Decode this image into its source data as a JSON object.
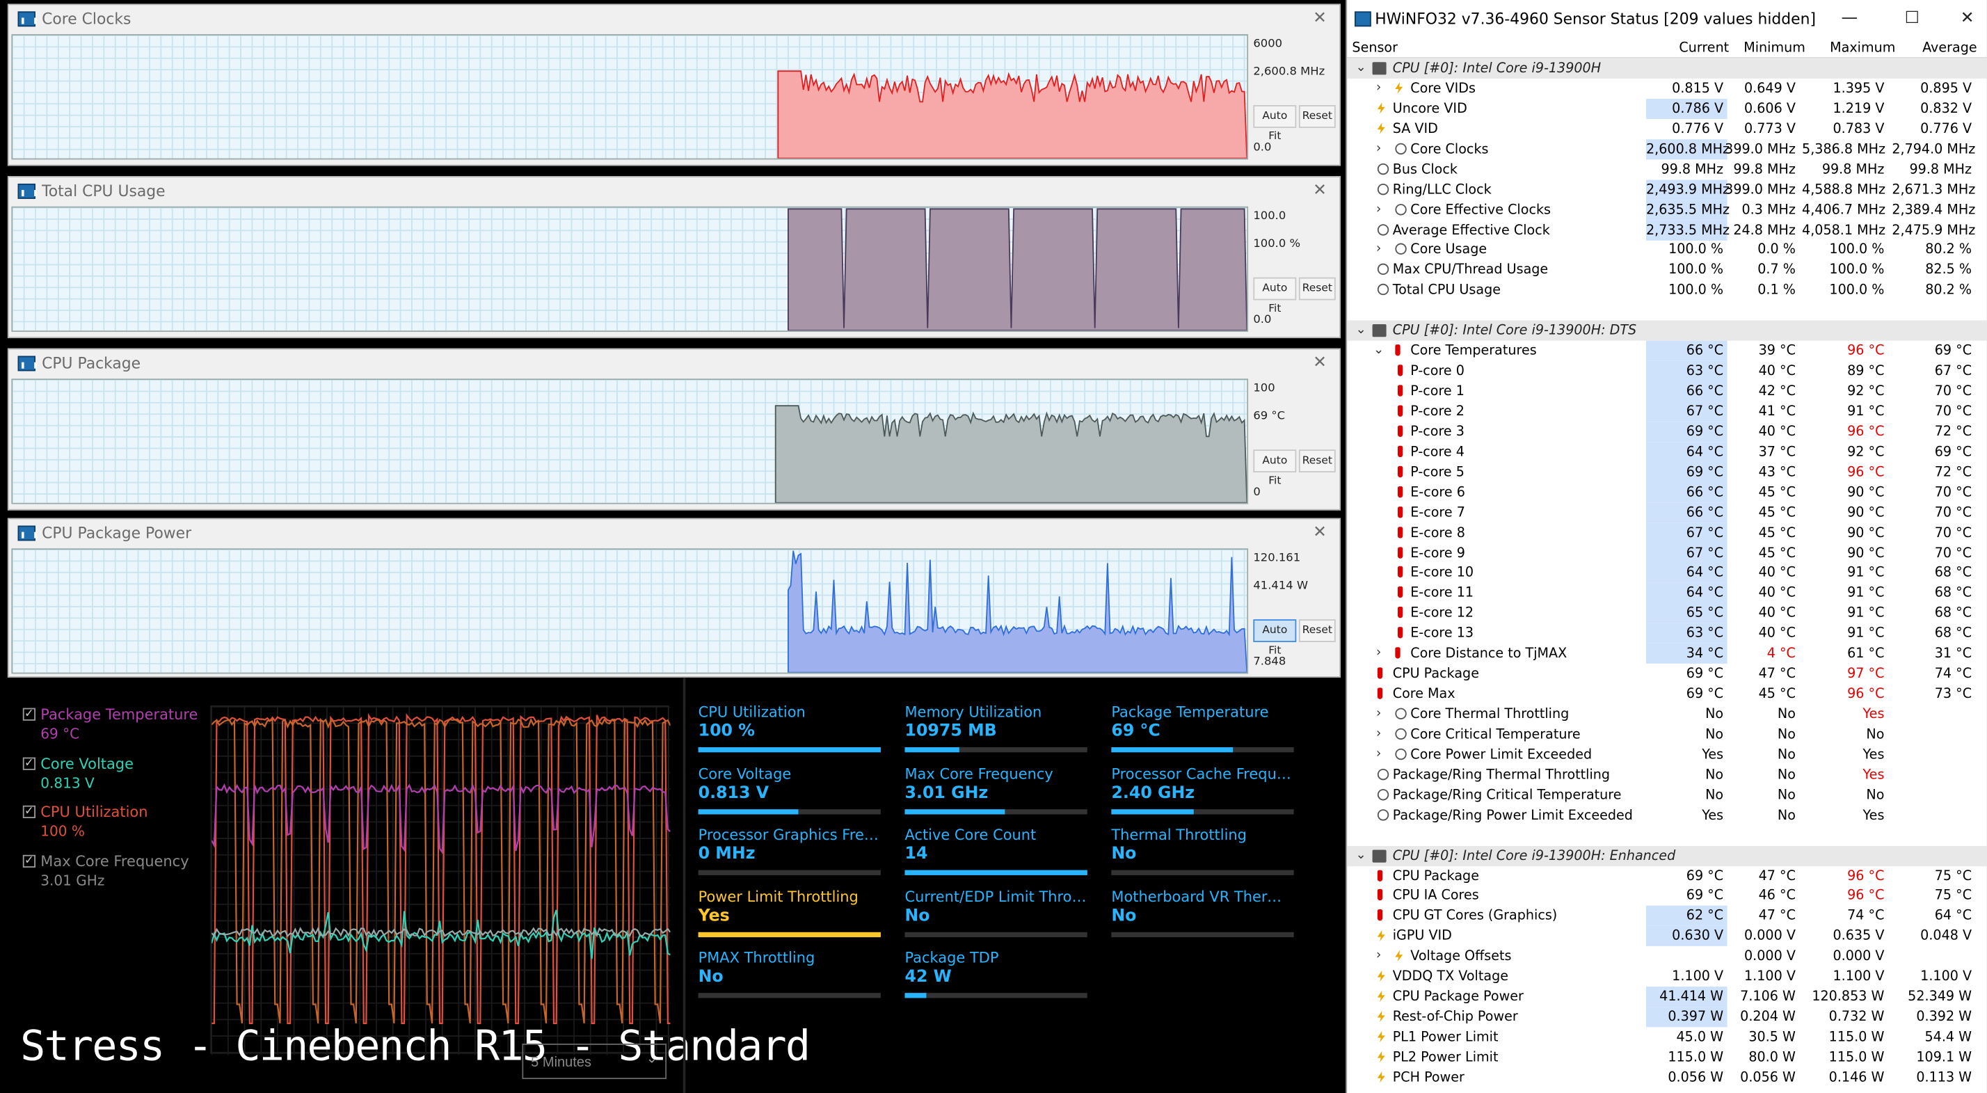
{
  "graphs": [
    {
      "title": "Core Clocks",
      "top_label": "6000",
      "cur_label": "2,600.8 MHz",
      "bottom_label": "0.0",
      "ymax": 6000,
      "fill": "#f7a8a8",
      "line": "#e02020",
      "start": 0.62,
      "base": 0.61,
      "noise": 0.08,
      "style": "normal",
      "autofit_active": false
    },
    {
      "title": "Total CPU Usage",
      "top_label": "100.0",
      "cur_label": "100.0 %",
      "bottom_label": "0.0",
      "ymax": 100,
      "fill": "#a896a8",
      "line": "#4a3a5a",
      "start": 0.628,
      "base": 1.0,
      "noise": 0,
      "style": "pulse",
      "autofit_active": false
    },
    {
      "title": "CPU Package",
      "top_label": "100",
      "cur_label": "69 °C",
      "bottom_label": "0",
      "ymax": 100,
      "fill": "#b2bcbc",
      "line": "#4d5a5a",
      "start": 0.618,
      "base": 0.69,
      "noise": 0.04,
      "style": "normal",
      "autofit_active": false
    },
    {
      "title": "CPU Package Power",
      "top_label": "120.161",
      "cur_label": "41.414 W",
      "bottom_label": "7.848",
      "ymax": 120.161,
      "fill": "#9fb0ee",
      "line": "#2f6fd8",
      "start": 0.628,
      "base": 0.31,
      "noise": 0.07,
      "style": "spiky",
      "autofit_active": true
    }
  ],
  "graph_buttons": {
    "autofit": "Auto Fit",
    "reset": "Reset"
  },
  "legend": [
    {
      "name": "Package Temperature",
      "value": "69 °C",
      "color": "#b33fb0"
    },
    {
      "name": "Core Voltage",
      "value": "0.813 V",
      "color": "#2ed3b8"
    },
    {
      "name": "CPU Utilization",
      "value": "100 %",
      "color": "#e0503a"
    },
    {
      "name": "Max Core Frequency",
      "value": "3.01 GHz",
      "color": "#8a8a8a"
    }
  ],
  "stress_label": "Stress - Cinebench R15 - Standard",
  "dropdown_value": "5 Minutes",
  "stats": [
    {
      "title": "CPU Utilization",
      "value": "100 %",
      "pct": 100,
      "warn": false
    },
    {
      "title": "Memory Utilization",
      "value": "10975  MB",
      "pct": 30,
      "warn": false
    },
    {
      "title": "Package Temperature",
      "value": "69 °C",
      "pct": 67,
      "warn": false
    },
    {
      "title": "Core Voltage",
      "value": "0.813 V",
      "pct": 55,
      "warn": false
    },
    {
      "title": "Max Core Frequency",
      "value": "3.01 GHz",
      "pct": 55,
      "warn": false
    },
    {
      "title": "Processor Cache Frequency",
      "value": "2.40 GHz",
      "pct": 45,
      "warn": false
    },
    {
      "title": "Processor Graphics Freque...",
      "value": "0 MHz",
      "pct": 0,
      "warn": false
    },
    {
      "title": "Active Core Count",
      "value": "14",
      "pct": 100,
      "warn": false
    },
    {
      "title": "Thermal Throttling",
      "value": "No",
      "pct": 0,
      "warn": false
    },
    {
      "title": "Power Limit Throttling",
      "value": "Yes",
      "pct": 100,
      "warn": true
    },
    {
      "title": "Current/EDP Limit Throttli...",
      "value": "No",
      "pct": 0,
      "warn": false
    },
    {
      "title": "Motherboard VR Thermal...",
      "value": "No",
      "pct": 0,
      "warn": false
    },
    {
      "title": "PMAX Throttling",
      "value": "No",
      "pct": 0,
      "warn": false
    },
    {
      "title": "Package TDP",
      "value": "42 W",
      "pct": 12,
      "warn": false
    }
  ],
  "hwinfo": {
    "title": "HWiNFO32 v7.36-4960 Sensor Status [209 values hidden]",
    "columns": {
      "sensor": "Sensor",
      "current": "Current",
      "minimum": "Minimum",
      "maximum": "Maximum",
      "average": "Average"
    },
    "rows": [
      {
        "type": "group",
        "name": "CPU [#0]: Intel Core i9-13900H"
      },
      {
        "icon": "vlt",
        "exp": "›",
        "ind": 1,
        "name": "Core VIDs",
        "cur": "0.815 V",
        "min": "0.649 V",
        "max": "1.395 V",
        "avg": "0.895 V"
      },
      {
        "icon": "vlt",
        "ind": 0,
        "name": "Uncore VID",
        "cur": "0.786 V",
        "min": "0.606 V",
        "max": "1.219 V",
        "avg": "0.832 V",
        "hl": true
      },
      {
        "icon": "vlt",
        "ind": 0,
        "name": "SA VID",
        "cur": "0.776 V",
        "min": "0.773 V",
        "max": "0.783 V",
        "avg": "0.776 V"
      },
      {
        "icon": "clk",
        "exp": "›",
        "ind": 1,
        "name": "Core Clocks",
        "cur": "2,600.8 MHz",
        "min": "399.0 MHz",
        "max": "5,386.8 MHz",
        "avg": "2,794.0 MHz",
        "hl": true
      },
      {
        "icon": "clk",
        "ind": 0,
        "name": "Bus Clock",
        "cur": "99.8 MHz",
        "min": "99.8 MHz",
        "max": "99.8 MHz",
        "avg": "99.8 MHz"
      },
      {
        "icon": "clk",
        "ind": 0,
        "name": "Ring/LLC Clock",
        "cur": "2,493.9 MHz",
        "min": "399.0 MHz",
        "max": "4,588.8 MHz",
        "avg": "2,671.3 MHz",
        "hl": true
      },
      {
        "icon": "clk",
        "exp": "›",
        "ind": 1,
        "name": "Core Effective Clocks",
        "cur": "2,635.5 MHz",
        "min": "0.3 MHz",
        "max": "4,406.7 MHz",
        "avg": "2,389.4 MHz",
        "hl": true
      },
      {
        "icon": "clk",
        "ind": 0,
        "name": "Average Effective Clock",
        "cur": "2,733.5 MHz",
        "min": "24.8 MHz",
        "max": "4,058.1 MHz",
        "avg": "2,475.9 MHz",
        "hl": true
      },
      {
        "icon": "clk",
        "exp": "›",
        "ind": 1,
        "name": "Core Usage",
        "cur": "100.0 %",
        "min": "0.0 %",
        "max": "100.0 %",
        "avg": "80.2 %"
      },
      {
        "icon": "clk",
        "ind": 0,
        "name": "Max CPU/Thread Usage",
        "cur": "100.0 %",
        "min": "0.7 %",
        "max": "100.0 %",
        "avg": "82.5 %"
      },
      {
        "icon": "clk",
        "ind": 0,
        "name": "Total CPU Usage",
        "cur": "100.0 %",
        "min": "0.1 %",
        "max": "100.0 %",
        "avg": "80.2 %"
      },
      {
        "type": "blank"
      },
      {
        "type": "group",
        "name": "CPU [#0]: Intel Core i9-13900H: DTS"
      },
      {
        "icon": "tmp",
        "exp": "⌄",
        "ind": 1,
        "name": "Core Temperatures",
        "cur": "66 °C",
        "min": "39 °C",
        "max": "96 °C",
        "avg": "69 °C",
        "hl": true,
        "maxred": true
      },
      {
        "icon": "tmp",
        "ind": 2,
        "name": "P-core 0",
        "cur": "63 °C",
        "min": "40 °C",
        "max": "89 °C",
        "avg": "67 °C",
        "hl": true
      },
      {
        "icon": "tmp",
        "ind": 2,
        "name": "P-core 1",
        "cur": "66 °C",
        "min": "42 °C",
        "max": "92 °C",
        "avg": "70 °C",
        "hl": true
      },
      {
        "icon": "tmp",
        "ind": 2,
        "name": "P-core 2",
        "cur": "67 °C",
        "min": "41 °C",
        "max": "91 °C",
        "avg": "70 °C",
        "hl": true
      },
      {
        "icon": "tmp",
        "ind": 2,
        "name": "P-core 3",
        "cur": "69 °C",
        "min": "40 °C",
        "max": "96 °C",
        "avg": "72 °C",
        "hl": true,
        "maxred": true
      },
      {
        "icon": "tmp",
        "ind": 2,
        "name": "P-core 4",
        "cur": "64 °C",
        "min": "37 °C",
        "max": "92 °C",
        "avg": "69 °C",
        "hl": true
      },
      {
        "icon": "tmp",
        "ind": 2,
        "name": "P-core 5",
        "cur": "69 °C",
        "min": "43 °C",
        "max": "96 °C",
        "avg": "72 °C",
        "hl": true,
        "maxred": true
      },
      {
        "icon": "tmp",
        "ind": 2,
        "name": "E-core 6",
        "cur": "66 °C",
        "min": "45 °C",
        "max": "90 °C",
        "avg": "70 °C",
        "hl": true
      },
      {
        "icon": "tmp",
        "ind": 2,
        "name": "E-core 7",
        "cur": "66 °C",
        "min": "45 °C",
        "max": "90 °C",
        "avg": "70 °C",
        "hl": true
      },
      {
        "icon": "tmp",
        "ind": 2,
        "name": "E-core 8",
        "cur": "67 °C",
        "min": "45 °C",
        "max": "90 °C",
        "avg": "70 °C",
        "hl": true
      },
      {
        "icon": "tmp",
        "ind": 2,
        "name": "E-core 9",
        "cur": "67 °C",
        "min": "45 °C",
        "max": "90 °C",
        "avg": "70 °C",
        "hl": true
      },
      {
        "icon": "tmp",
        "ind": 2,
        "name": "E-core 10",
        "cur": "64 °C",
        "min": "40 °C",
        "max": "91 °C",
        "avg": "68 °C",
        "hl": true
      },
      {
        "icon": "tmp",
        "ind": 2,
        "name": "E-core 11",
        "cur": "64 °C",
        "min": "40 °C",
        "max": "91 °C",
        "avg": "68 °C",
        "hl": true
      },
      {
        "icon": "tmp",
        "ind": 2,
        "name": "E-core 12",
        "cur": "65 °C",
        "min": "40 °C",
        "max": "91 °C",
        "avg": "68 °C",
        "hl": true
      },
      {
        "icon": "tmp",
        "ind": 2,
        "name": "E-core 13",
        "cur": "63 °C",
        "min": "40 °C",
        "max": "91 °C",
        "avg": "68 °C",
        "hl": true
      },
      {
        "icon": "tmp",
        "exp": "›",
        "ind": 1,
        "name": "Core Distance to TjMAX",
        "cur": "34 °C",
        "min": "4 °C",
        "max": "61 °C",
        "avg": "31 °C",
        "hl": true,
        "minred": true
      },
      {
        "icon": "tmp",
        "ind": 0,
        "name": "CPU Package",
        "cur": "69 °C",
        "min": "47 °C",
        "max": "97 °C",
        "avg": "74 °C",
        "maxred": true
      },
      {
        "icon": "tmp",
        "ind": 0,
        "name": "Core Max",
        "cur": "69 °C",
        "min": "45 °C",
        "max": "96 °C",
        "avg": "73 °C",
        "maxred": true
      },
      {
        "icon": "clk",
        "exp": "›",
        "ind": 1,
        "name": "Core Thermal Throttling",
        "cur": "No",
        "min": "No",
        "max": "Yes",
        "avg": "",
        "maxred": true
      },
      {
        "icon": "clk",
        "exp": "›",
        "ind": 1,
        "name": "Core Critical Temperature",
        "cur": "No",
        "min": "No",
        "max": "No",
        "avg": ""
      },
      {
        "icon": "clk",
        "exp": "›",
        "ind": 1,
        "name": "Core Power Limit Exceeded",
        "cur": "Yes",
        "min": "No",
        "max": "Yes",
        "avg": ""
      },
      {
        "icon": "clk",
        "ind": 0,
        "name": "Package/Ring Thermal Throttling",
        "cur": "No",
        "min": "No",
        "max": "Yes",
        "avg": "",
        "maxred": true
      },
      {
        "icon": "clk",
        "ind": 0,
        "name": "Package/Ring Critical Temperature",
        "cur": "No",
        "min": "No",
        "max": "No",
        "avg": ""
      },
      {
        "icon": "clk",
        "ind": 0,
        "name": "Package/Ring Power Limit Exceeded",
        "cur": "Yes",
        "min": "No",
        "max": "Yes",
        "avg": ""
      },
      {
        "type": "blank"
      },
      {
        "type": "group",
        "name": "CPU [#0]: Intel Core i9-13900H: Enhanced"
      },
      {
        "icon": "tmp",
        "ind": 0,
        "name": "CPU Package",
        "cur": "69 °C",
        "min": "47 °C",
        "max": "96 °C",
        "avg": "75 °C",
        "maxred": true
      },
      {
        "icon": "tmp",
        "ind": 0,
        "name": "CPU IA Cores",
        "cur": "69 °C",
        "min": "46 °C",
        "max": "96 °C",
        "avg": "75 °C",
        "maxred": true
      },
      {
        "icon": "tmp",
        "ind": 0,
        "name": "CPU GT Cores (Graphics)",
        "cur": "62 °C",
        "min": "47 °C",
        "max": "74 °C",
        "avg": "64 °C",
        "hl": true
      },
      {
        "icon": "vlt",
        "ind": 0,
        "name": "iGPU VID",
        "cur": "0.630 V",
        "min": "0.000 V",
        "max": "0.635 V",
        "avg": "0.048 V",
        "hl": true
      },
      {
        "icon": "vlt",
        "exp": "›",
        "ind": 1,
        "name": "Voltage Offsets",
        "cur": "",
        "min": "0.000 V",
        "max": "0.000 V",
        "avg": ""
      },
      {
        "icon": "vlt",
        "ind": 0,
        "name": "VDDQ TX Voltage",
        "cur": "1.100 V",
        "min": "1.100 V",
        "max": "1.100 V",
        "avg": "1.100 V"
      },
      {
        "icon": "pwr",
        "ind": 0,
        "name": "CPU Package Power",
        "cur": "41.414 W",
        "min": "7.106 W",
        "max": "120.853 W",
        "avg": "52.349 W",
        "hl": true
      },
      {
        "icon": "pwr",
        "ind": 0,
        "name": "Rest-of-Chip Power",
        "cur": "0.397 W",
        "min": "0.204 W",
        "max": "0.732 W",
        "avg": "0.392 W",
        "hl": true
      },
      {
        "icon": "pwr",
        "ind": 0,
        "name": "PL1 Power Limit",
        "cur": "45.0 W",
        "min": "30.5 W",
        "max": "115.0 W",
        "avg": "54.4 W"
      },
      {
        "icon": "pwr",
        "ind": 0,
        "name": "PL2 Power Limit",
        "cur": "115.0 W",
        "min": "80.0 W",
        "max": "115.0 W",
        "avg": "109.1 W"
      },
      {
        "icon": "pwr",
        "ind": 0,
        "name": "PCH Power",
        "cur": "0.056 W",
        "min": "0.056 W",
        "max": "0.146 W",
        "avg": "0.113 W"
      }
    ]
  }
}
